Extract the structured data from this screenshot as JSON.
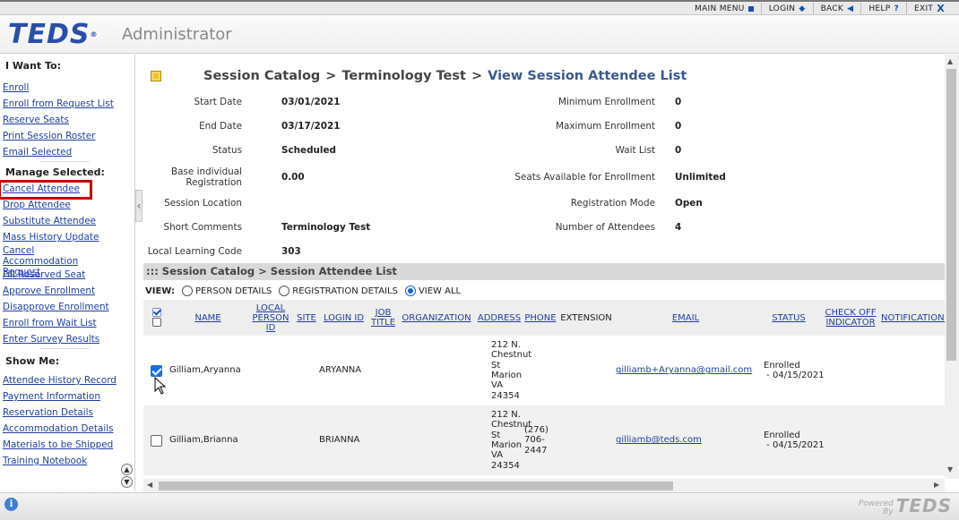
{
  "topnav": [
    {
      "label": "MAIN MENU",
      "icon": "square-icon"
    },
    {
      "label": "LOGIN",
      "icon": "diamond-icon"
    },
    {
      "label": "BACK",
      "icon": "triangle-left-icon"
    },
    {
      "label": "HELP",
      "icon": "question-icon"
    },
    {
      "label": "EXIT",
      "icon": "x-icon"
    }
  ],
  "header": {
    "logo": "TEDS",
    "logo_reg": "®",
    "title": "Administrator"
  },
  "sidebar": {
    "i_want_to": "I Want To:",
    "i_want_to_links": [
      "Enroll",
      "Enroll from Request List",
      "Reserve Seats",
      "Print Session Roster",
      "Email Selected"
    ],
    "manage_selected": "Manage Selected:",
    "manage_links": [
      "Cancel Attendee",
      "Drop Attendee",
      "Substitute Attendee",
      "Mass History Update",
      "Cancel Accommodation Request",
      "Fill Reserved Seat",
      "Approve Enrollment",
      "Disapprove Enrollment",
      "Enroll from Wait List",
      "Enter Survey Results"
    ],
    "show_me": "Show Me:",
    "show_links": [
      "Attendee History Record",
      "Payment Information",
      "Reservation Details",
      "Accommodation Details",
      "Materials to be Shipped",
      "Training Notebook"
    ]
  },
  "breadcrumb": {
    "part1": "Session Catalog",
    "sep": ">",
    "part2": "Terminology Test",
    "current": "View Session Attendee List"
  },
  "details_left": [
    {
      "label": "Start Date",
      "value": "03/01/2021"
    },
    {
      "label": "End Date",
      "value": "03/17/2021"
    },
    {
      "label": "Status",
      "value": "Scheduled"
    },
    {
      "label": "Base individual Registration",
      "value": "0.00"
    },
    {
      "label": "Session Location",
      "value": ""
    },
    {
      "label": "Short Comments",
      "value": "Terminology Test"
    },
    {
      "label": "Local Learning Code",
      "value": "303"
    }
  ],
  "details_right": [
    {
      "label": "Minimum Enrollment",
      "value": "0"
    },
    {
      "label": "Maximum Enrollment",
      "value": "0"
    },
    {
      "label": "Wait List",
      "value": "0"
    },
    {
      "label": "Seats Available for Enrollment",
      "value": "Unlimited"
    },
    {
      "label": "Registration Mode",
      "value": "Open"
    },
    {
      "label": "Number of Attendees",
      "value": "4"
    }
  ],
  "section_bar": "::: Session Catalog > Session Attendee List",
  "view": {
    "label": "VIEW:",
    "options": [
      "PERSON DETAILS",
      "REGISTRATION DETAILS",
      "VIEW ALL"
    ],
    "selected": "VIEW ALL"
  },
  "table": {
    "headers": [
      "NAME",
      "LOCAL PERSON ID",
      "SITE",
      "LOGIN ID",
      "JOB TITLE",
      "ORGANIZATION",
      "ADDRESS",
      "PHONE",
      "EXTENSION",
      "EMAIL",
      "STATUS",
      "CHECK OFF INDICATOR",
      "NOTIFICATION DATE"
    ],
    "rows": [
      {
        "checked": true,
        "name": "Gilliam,Aryanna",
        "login_id": "ARYANNA",
        "address": [
          "212 N.",
          "Chestnut",
          "St",
          "Marion",
          "VA",
          "24354"
        ],
        "phone": [],
        "email": "gilliamb+Aryanna@gmail.com",
        "status": "Enrolled",
        "status_date": " - 04/15/2021"
      },
      {
        "checked": false,
        "name": "Gilliam,Brianna",
        "login_id": "BRIANNA",
        "address": [
          "212 N.",
          "Chestnut",
          "St",
          "Marion",
          "VA",
          "24354"
        ],
        "phone": [
          "(276)",
          "706-",
          "2447"
        ],
        "email": "gilliamb@teds.com",
        "status": "Enrolled",
        "status_date": " - 04/15/2021"
      }
    ]
  },
  "footer": {
    "powered": "Powered",
    "by": "By",
    "logo": "TEDS"
  }
}
